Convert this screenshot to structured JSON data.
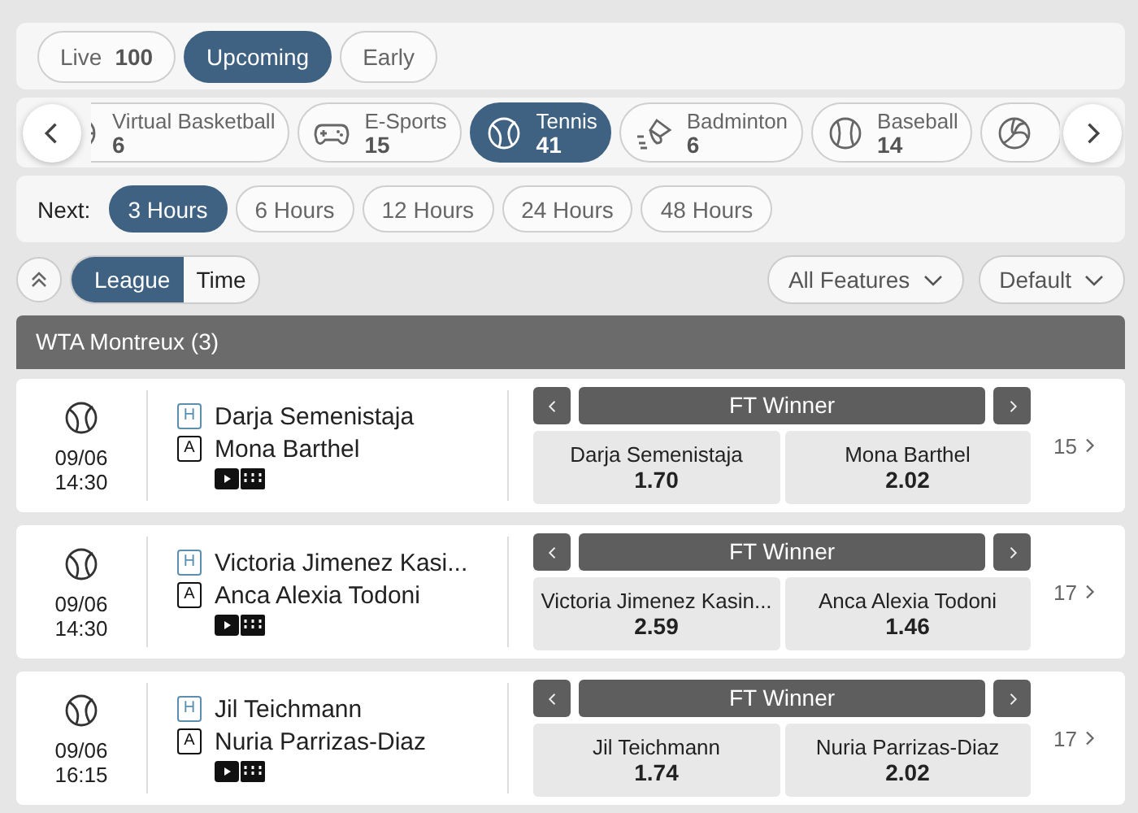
{
  "event_tabs": [
    {
      "label": "Live",
      "count": "100",
      "selected": false
    },
    {
      "label": "Upcoming",
      "selected": true
    },
    {
      "label": "Early",
      "selected": false
    }
  ],
  "sports": [
    {
      "kind": "basketball",
      "label": "Virtual Basketball",
      "count": "6",
      "selected": false
    },
    {
      "kind": "esports",
      "label": "E-Sports",
      "count": "15",
      "selected": false
    },
    {
      "kind": "tennis",
      "label": "Tennis",
      "count": "41",
      "selected": true
    },
    {
      "kind": "badminton",
      "label": "Badminton",
      "count": "6",
      "selected": false
    },
    {
      "kind": "baseball",
      "label": "Baseball",
      "count": "14",
      "selected": false
    },
    {
      "kind": "volleyball",
      "selected": false
    }
  ],
  "time_filter": {
    "label": "Next:",
    "options": [
      {
        "label": "3 Hours",
        "selected": true
      },
      {
        "label": "6 Hours",
        "selected": false
      },
      {
        "label": "12 Hours",
        "selected": false
      },
      {
        "label": "24 Hours",
        "selected": false
      },
      {
        "label": "48 Hours",
        "selected": false
      }
    ]
  },
  "grouping": [
    {
      "label": "League",
      "selected": true
    },
    {
      "label": "Time",
      "selected": false
    }
  ],
  "dropdowns": [
    {
      "label": "All Features"
    },
    {
      "label": "Default"
    }
  ],
  "league": {
    "title": "WTA Montreux (3)",
    "matches": [
      {
        "date": "09/06",
        "time": "14:30",
        "home_badge": "H",
        "home": "Darja Semenistaja",
        "away_badge": "A",
        "away": "Mona Barthel",
        "market": "FT Winner",
        "odds": [
          {
            "label": "Darja Semenistaja",
            "price": "1.70"
          },
          {
            "label": "Mona Barthel",
            "price": "2.02"
          }
        ],
        "more": "15"
      },
      {
        "date": "09/06",
        "time": "14:30",
        "home_badge": "H",
        "home": "Victoria Jimenez Kasi...",
        "away_badge": "A",
        "away": "Anca Alexia Todoni",
        "market": "FT Winner",
        "odds": [
          {
            "label": "Victoria Jimenez Kasin...",
            "price": "2.59"
          },
          {
            "label": "Anca Alexia Todoni",
            "price": "1.46"
          }
        ],
        "more": "17"
      },
      {
        "date": "09/06",
        "time": "16:15",
        "home_badge": "H",
        "home": "Jil Teichmann",
        "away_badge": "A",
        "away": "Nuria Parrizas-Diaz",
        "market": "FT Winner",
        "odds": [
          {
            "label": "Jil Teichmann",
            "price": "1.74"
          },
          {
            "label": "Nuria Parrizas-Diaz",
            "price": "2.02"
          }
        ],
        "more": "17"
      }
    ]
  }
}
